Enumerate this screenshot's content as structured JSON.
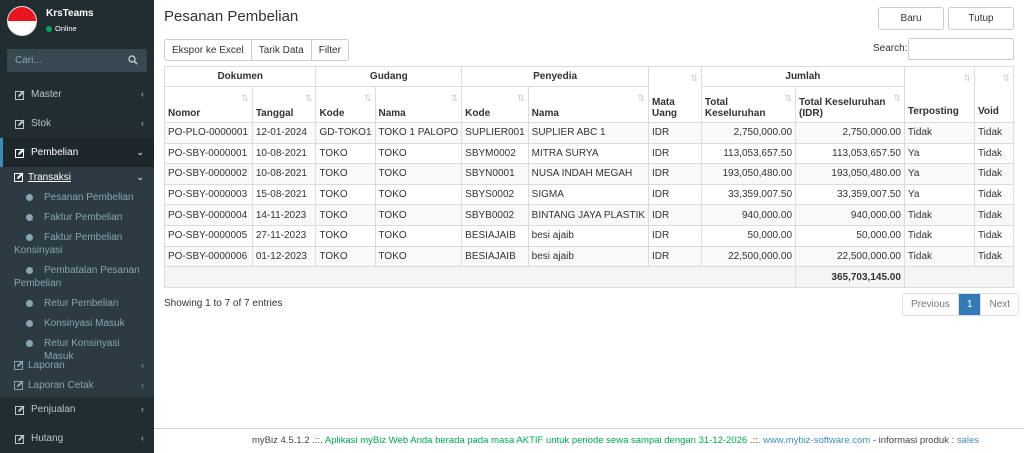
{
  "sidebar": {
    "user_name": "KrsTeams",
    "user_status": "Online",
    "search_placeholder": "Cari...",
    "menu": {
      "master": "Master",
      "stok": "Stok",
      "pembelian": "Pembelian",
      "transaksi": "Transaksi",
      "pesanan_pembelian": "Pesanan Pembelian",
      "faktur_pembelian": "Faktur Pembelian",
      "faktur_pembelian_konsinyasi_1": "Faktur Pembelian",
      "faktur_pembelian_konsinyasi_2": "Konsinyasi",
      "pembatalan_pesanan_1": "Pembatalan Pesanan",
      "pembatalan_pesanan_2": "Pembelian",
      "retur_pembelian": "Retur Pembelian",
      "konsinyasi_masuk": "Konsinyasi Masuk",
      "retur_konsinyasi_masuk": "Retur Konsinyasi Masuk",
      "laporan": "Laporan",
      "laporan_cetak": "Laporan Cetak",
      "penjualan": "Penjualan",
      "hutang": "Hutang"
    }
  },
  "header": {
    "title": "Pesanan Pembelian",
    "btn_baru": "Baru",
    "btn_tutup": "Tutup"
  },
  "toolbar": {
    "export_excel": "Ekspor ke Excel",
    "tarik_data": "Tarik Data",
    "filter": "Filter",
    "search_label": "Search:"
  },
  "table": {
    "groups": {
      "dokumen": "Dokumen",
      "gudang": "Gudang",
      "penyedia": "Penyedia",
      "jumlah": "Jumlah"
    },
    "columns": {
      "nomor": "Nomor",
      "tanggal": "Tanggal",
      "gudang_kode": "Kode",
      "gudang_nama": "Nama",
      "penyedia_kode": "Kode",
      "penyedia_nama": "Nama",
      "mata_uang_1": "Mata",
      "mata_uang_2": "Uang",
      "total_1": "Total",
      "total_2": "Keseluruhan",
      "total_idr_1": "Total Keseluruhan",
      "total_idr_2": "(IDR)",
      "terposting": "Terposting",
      "void": "Void"
    },
    "rows": [
      [
        "PO-PLO-0000001",
        "12-01-2024",
        "GD-TOKO1",
        "TOKO 1 PALOPO",
        "SUPLIER001",
        "SUPLIER ABC 1",
        "IDR",
        "2,750,000.00",
        "2,750,000.00",
        "Tidak",
        "Tidak"
      ],
      [
        "PO-SBY-0000001",
        "10-08-2021",
        "TOKO",
        "TOKO",
        "SBYM0002",
        "MITRA SURYA",
        "IDR",
        "113,053,657.50",
        "113,053,657.50",
        "Ya",
        "Tidak"
      ],
      [
        "PO-SBY-0000002",
        "10-08-2021",
        "TOKO",
        "TOKO",
        "SBYN0001",
        "NUSA INDAH MEGAH",
        "IDR",
        "193,050,480.00",
        "193,050,480.00",
        "Ya",
        "Tidak"
      ],
      [
        "PO-SBY-0000003",
        "15-08-2021",
        "TOKO",
        "TOKO",
        "SBYS0002",
        "SIGMA",
        "IDR",
        "33,359,007.50",
        "33,359,007.50",
        "Ya",
        "Tidak"
      ],
      [
        "PO-SBY-0000004",
        "14-11-2023",
        "TOKO",
        "TOKO",
        "SBYB0002",
        "BINTANG JAYA PLASTIK",
        "IDR",
        "940,000.00",
        "940,000.00",
        "Tidak",
        "Tidak"
      ],
      [
        "PO-SBY-0000005",
        "27-11-2023",
        "TOKO",
        "TOKO",
        "BESIAJAIB",
        "besi ajaib",
        "IDR",
        "50,000.00",
        "50,000.00",
        "Tidak",
        "Tidak"
      ],
      [
        "PO-SBY-0000006",
        "01-12-2023",
        "TOKO",
        "TOKO",
        "BESIAJAIB",
        "besi ajaib",
        "IDR",
        "22,500,000.00",
        "22,500,000.00",
        "Tidak",
        "Tidak"
      ]
    ],
    "grand_total": "365,703,145.00"
  },
  "pagination": {
    "info": "Showing 1 to 7 of 7 entries",
    "previous": "Previous",
    "current": "1",
    "next": "Next"
  },
  "footer": {
    "version": "myBiz 4.5.1.2",
    "sep1": ".::.",
    "notice": "Aplikasi myBiz Web Anda berada pada masa AKTIF untuk periode sewa sampai dengan 31-12-2026",
    "sep2": ".::.",
    "website": "www.mybiz-software.com",
    "info_prefix": "- informasi produk :",
    "info_link": "sales"
  },
  "colors": {
    "sidebar_bg": "#222d32",
    "accent": "#3c8dbc",
    "online": "#00a65a",
    "pager_active": "#337ab7"
  }
}
